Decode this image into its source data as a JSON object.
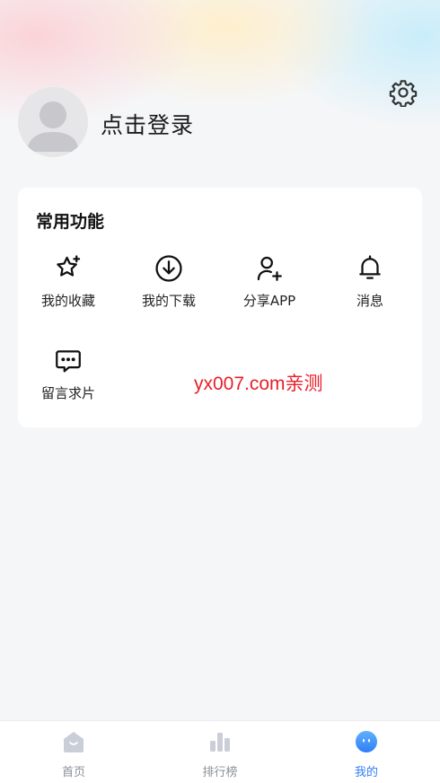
{
  "header": {
    "login_text": "点击登录"
  },
  "common": {
    "title": "常用功能",
    "items": [
      {
        "label": "我的收藏",
        "icon": "star-icon"
      },
      {
        "label": "我的下载",
        "icon": "download-icon"
      },
      {
        "label": "分享APP",
        "icon": "share-user-icon"
      },
      {
        "label": "消息",
        "icon": "bell-icon"
      },
      {
        "label": "留言求片",
        "icon": "message-icon"
      }
    ]
  },
  "watermark": "yx007.com亲测",
  "tabbar": {
    "tabs": [
      {
        "label": "首页",
        "icon": "home-icon"
      },
      {
        "label": "排行榜",
        "icon": "ranking-icon"
      },
      {
        "label": "我的",
        "icon": "profile-icon"
      }
    ],
    "active_index": 2,
    "active_color": "#2f7df6",
    "inactive_color": "#8a8f99"
  }
}
